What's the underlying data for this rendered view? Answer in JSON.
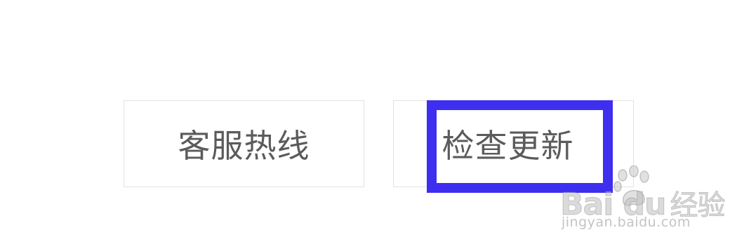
{
  "buttons": {
    "hotline_label": "客服热线",
    "update_label": "检查更新"
  },
  "watermark": {
    "brand": "Bai du",
    "brand_cn": "经验",
    "url": "jingyan.baidu.com"
  },
  "colors": {
    "highlight": "#3d2ef0",
    "button_text": "#5b5b5b",
    "button_border": "#e3e3e3"
  }
}
